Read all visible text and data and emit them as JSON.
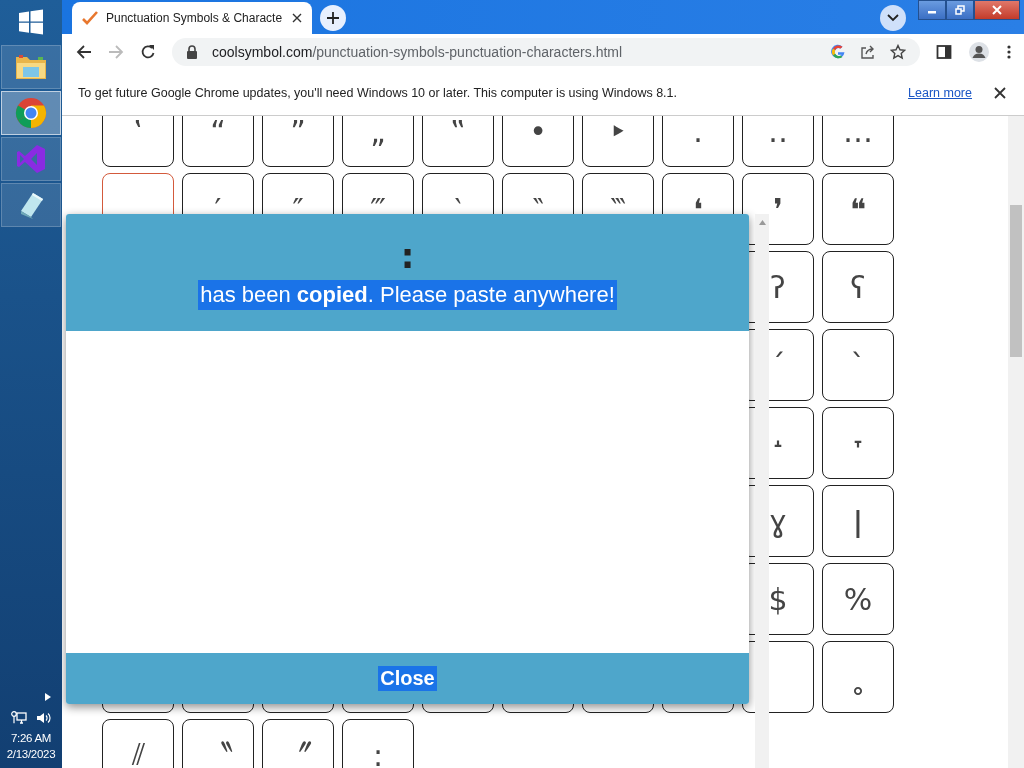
{
  "taskbar": {
    "apps": [
      {
        "kind": "explorer",
        "selected": false
      },
      {
        "kind": "chrome",
        "selected": true
      },
      {
        "kind": "studio",
        "selected": false
      },
      {
        "kind": "notes",
        "selected": false
      }
    ],
    "time": "7:26 AM",
    "date": "2/13/2023"
  },
  "browser": {
    "tab": {
      "title": "Punctuation Symbols & Characte"
    },
    "url": {
      "domain": "coolsymbol.com",
      "path": "/punctuation-symbols-punctuation-characters.html"
    },
    "infobar": {
      "message": "To get future Google Chrome updates, you'll need Windows 10 or later. This computer is using Windows 8.1.",
      "link": "Learn more"
    }
  },
  "grid": [
    {
      "keys": [
        {
          "symbol": "‛",
          "hovered": false
        },
        {
          "symbol": "“",
          "hovered": false
        },
        {
          "symbol": "”",
          "hovered": false
        },
        {
          "symbol": "„",
          "hovered": false
        },
        {
          "symbol": "‟",
          "hovered": false
        },
        {
          "symbol": "•",
          "hovered": false
        },
        {
          "symbol": "‣",
          "hovered": false
        },
        {
          "symbol": "․",
          "hovered": false
        },
        {
          "symbol": "‥",
          "hovered": false
        },
        {
          "symbol": "…",
          "hovered": false
        }
      ]
    },
    {
      "keys": [
        {
          "hovered": true
        },
        {
          "symbol": "′",
          "hovered": false
        },
        {
          "symbol": "″",
          "hovered": false
        },
        {
          "symbol": "‴",
          "hovered": false
        },
        {
          "symbol": "‵",
          "hovered": false
        },
        {
          "symbol": "‶",
          "hovered": false
        },
        {
          "symbol": "‷",
          "hovered": false
        },
        {
          "symbol": "❛",
          "hovered": false
        },
        {
          "symbol": "❜",
          "hovered": false
        },
        {
          "symbol": "❝",
          "hovered": false
        }
      ]
    },
    {
      "under_dialog": true,
      "keys": [
        {
          "symbol": "ʔ",
          "hovered": false
        },
        {
          "symbol": "ʕ",
          "hovered": false
        }
      ]
    },
    {
      "under_dialog": true,
      "keys": [
        {
          "symbol": "ˊ",
          "hovered": false
        },
        {
          "symbol": "ˋ",
          "hovered": false
        }
      ]
    },
    {
      "under_dialog": true,
      "keys": [
        {
          "symbol": "˔",
          "hovered": false
        },
        {
          "symbol": "˕",
          "hovered": false
        }
      ]
    },
    {
      "under_dialog": true,
      "keys": [
        {
          "symbol": "ɣ",
          "hovered": false
        },
        {
          "symbol": "ǀ",
          "hovered": false
        }
      ]
    },
    {
      "under_dialog": true,
      "keys": [
        {
          "symbol": "$",
          "hovered": false
        },
        {
          "symbol": "%",
          "hovered": false
        }
      ]
    },
    {
      "under_dialog": true,
      "keys": [
        {
          "hovered": false
        },
        {
          "symbol": "˳",
          "hovered": false
        }
      ]
    },
    {
      "keys": [
        {
          "symbol": "⫽",
          "hovered": false
        },
        {
          "symbol": "〝",
          "hovered": false
        },
        {
          "symbol": "〞",
          "hovered": false
        },
        {
          "symbol": ":",
          "hovered": false
        }
      ]
    }
  ],
  "modal": {
    "symbol": ":",
    "message": "has been **copied**. Please paste anywhere!",
    "button": "Close"
  }
}
